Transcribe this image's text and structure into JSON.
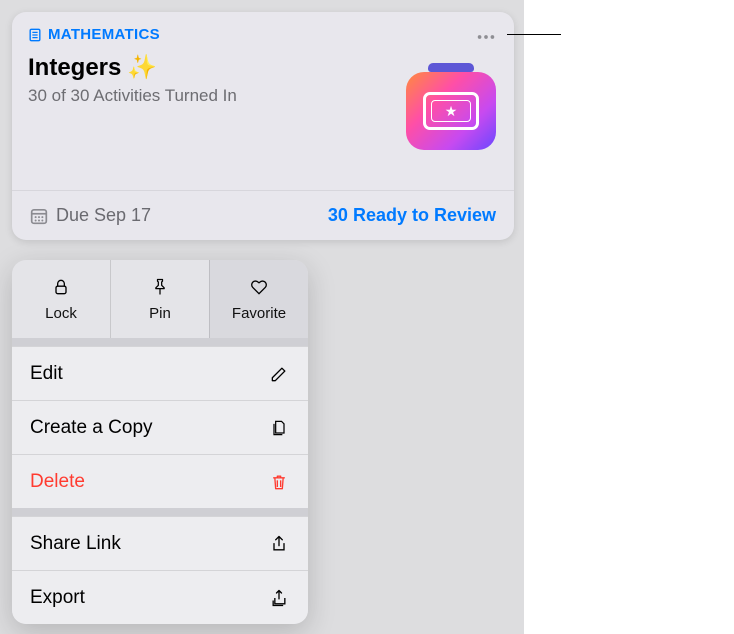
{
  "card": {
    "subject": "MATHEMATICS",
    "title": "Integers",
    "sparkle": "✨",
    "subtitle": "30 of 30 Activities Turned In",
    "due_label": "Due Sep 17",
    "ready_label": "30 Ready to Review"
  },
  "menu": {
    "top": {
      "lock": "Lock",
      "pin": "Pin",
      "favorite": "Favorite"
    },
    "items": {
      "edit": "Edit",
      "copy": "Create a Copy",
      "delete": "Delete",
      "share": "Share Link",
      "export": "Export"
    }
  },
  "colors": {
    "accent": "#007aff",
    "destructive": "#ff3b30"
  }
}
